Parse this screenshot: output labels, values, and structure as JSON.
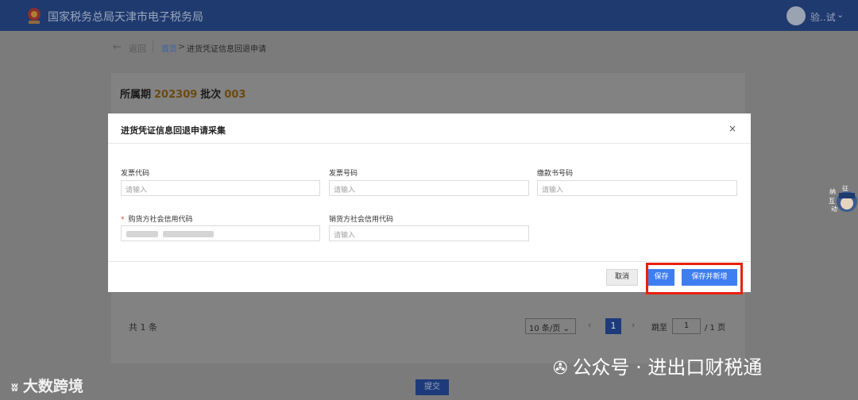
{
  "header": {
    "site_title": "国家税务总局天津市电子税务局",
    "user_name": "验..试",
    "user_menu_icon": "chevron-down-icon"
  },
  "breadcrumb": {
    "back_label": "返回",
    "home": "首页",
    "separator": ">",
    "current": "进货凭证信息回退申请"
  },
  "period": {
    "period_label": "所属期",
    "period_value": "202309",
    "batch_label": "批次",
    "batch_value": "003"
  },
  "pagination": {
    "total": "共 1 条",
    "page_size": "10 条/页",
    "current_page": "1",
    "jump_label": "跳至",
    "jump_value": "1",
    "total_pages": "/ 1 页"
  },
  "submit_label": "提交",
  "side_widget": {
    "text": "征纳互动"
  },
  "modal": {
    "title": "进货凭证信息回退申请采集",
    "close": "×",
    "fields": {
      "invoice_code_label": "发票代码",
      "invoice_code_placeholder": "请输入",
      "invoice_number_label": "发票号码",
      "invoice_number_placeholder": "请输入",
      "payment_number_label": "缴款书号码",
      "payment_number_placeholder": "请输入",
      "buyer_credit_code_label": "购货方社会信用代码",
      "buyer_credit_code_required": "*",
      "seller_credit_code_label": "销货方社会信用代码",
      "seller_credit_code_placeholder": "请输入"
    },
    "buttons": {
      "cancel": "取消",
      "save": "保存",
      "save_and_new": "保存并新增"
    }
  },
  "watermarks": {
    "left_text": "大数跨境",
    "right_text": "公众号 · 进出口财税通"
  },
  "colors": {
    "header_bg": "#1f3a6e",
    "primary_button": "#3f7ef0",
    "highlight": "#e8200c",
    "accent_number": "#f0a020"
  }
}
